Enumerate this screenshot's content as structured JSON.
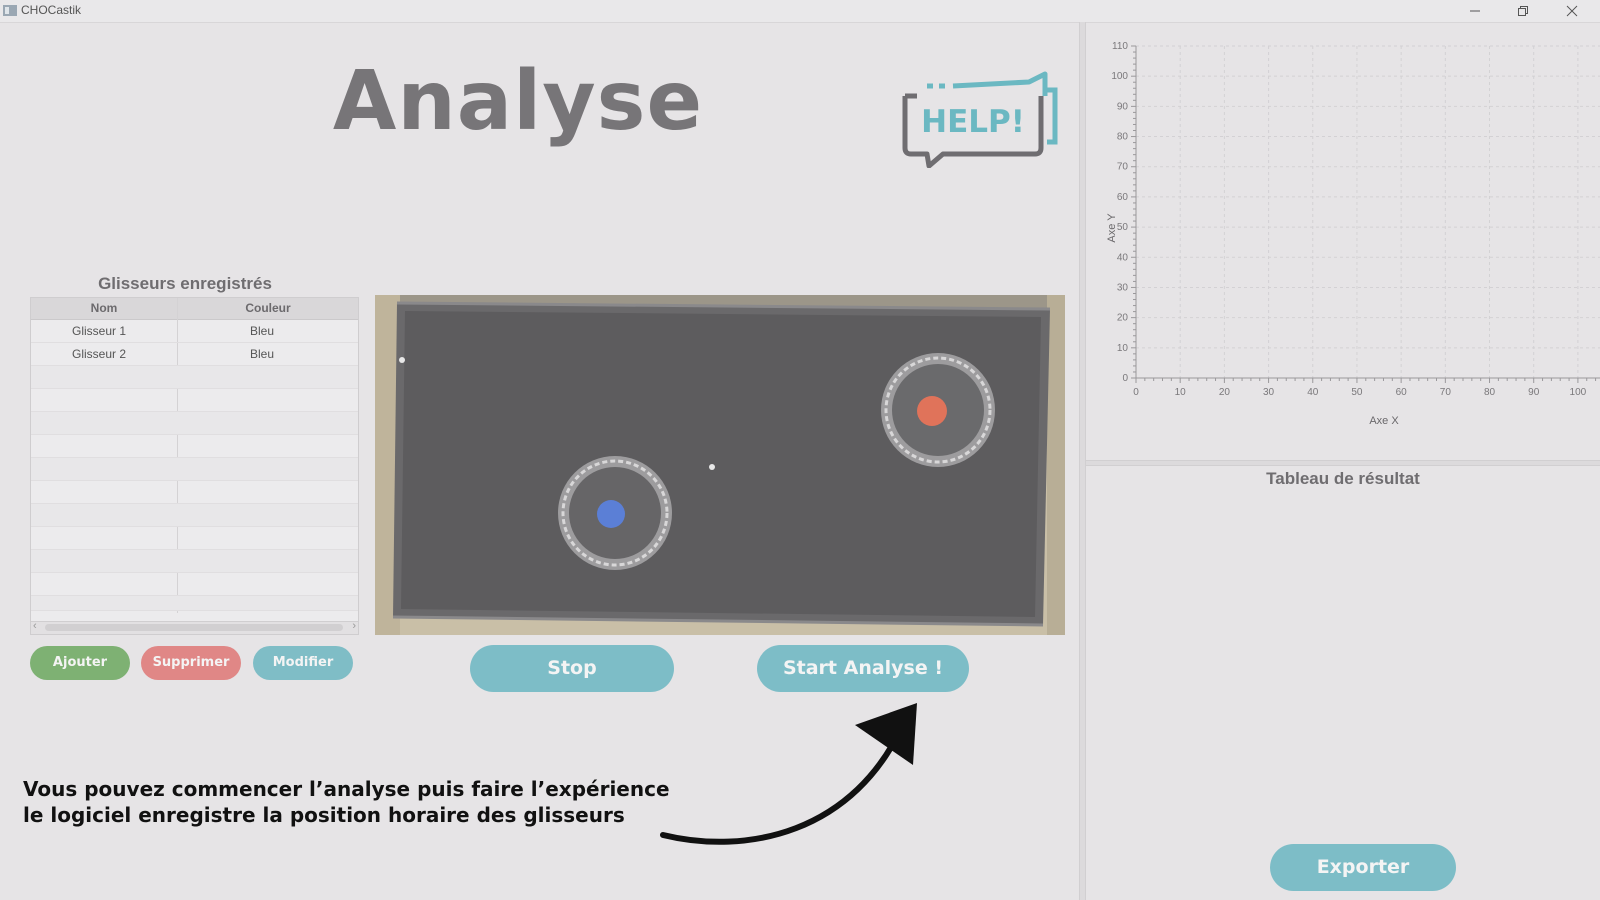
{
  "window": {
    "title": "CHOCastik",
    "minimize_icon": "minimize-icon",
    "restore_icon": "restore-icon",
    "close_icon": "close-icon"
  },
  "header": {
    "title": "Analyse",
    "help_label": "HELP!"
  },
  "sliders_panel": {
    "title": "Glisseurs enregistrés",
    "columns": [
      "Nom",
      "Couleur"
    ],
    "rows": [
      {
        "nom": "Glisseur 1",
        "couleur": "Bleu"
      },
      {
        "nom": "Glisseur 2",
        "couleur": "Bleu"
      }
    ],
    "buttons": {
      "add": "Ajouter",
      "delete": "Supprimer",
      "edit": "Modifier"
    }
  },
  "video_controls": {
    "stop": "Stop",
    "start": "Start Analyse !"
  },
  "instruction": {
    "line1": "Vous pouvez commencer l’analyse puis faire l’expérience",
    "line2": "le logiciel enregistre la position horaire des glisseurs"
  },
  "results": {
    "title": "Tableau de résultat",
    "export": "Exporter"
  },
  "colors": {
    "add": "#7eb173",
    "delete": "#e08786",
    "accent": "#7dbdc7",
    "puck_red": "#e0735a",
    "puck_blue": "#5b7fd6"
  },
  "chart_data": {
    "type": "scatter",
    "xlabel": "Axe X",
    "ylabel": "Axe Y",
    "xlim": [
      0,
      105
    ],
    "ylim": [
      0,
      110
    ],
    "x_ticks": [
      0,
      10,
      20,
      30,
      40,
      50,
      60,
      70,
      80,
      90,
      100
    ],
    "y_ticks": [
      0,
      10,
      20,
      30,
      40,
      50,
      60,
      70,
      80,
      90,
      100,
      110
    ],
    "grid": true,
    "series": []
  }
}
